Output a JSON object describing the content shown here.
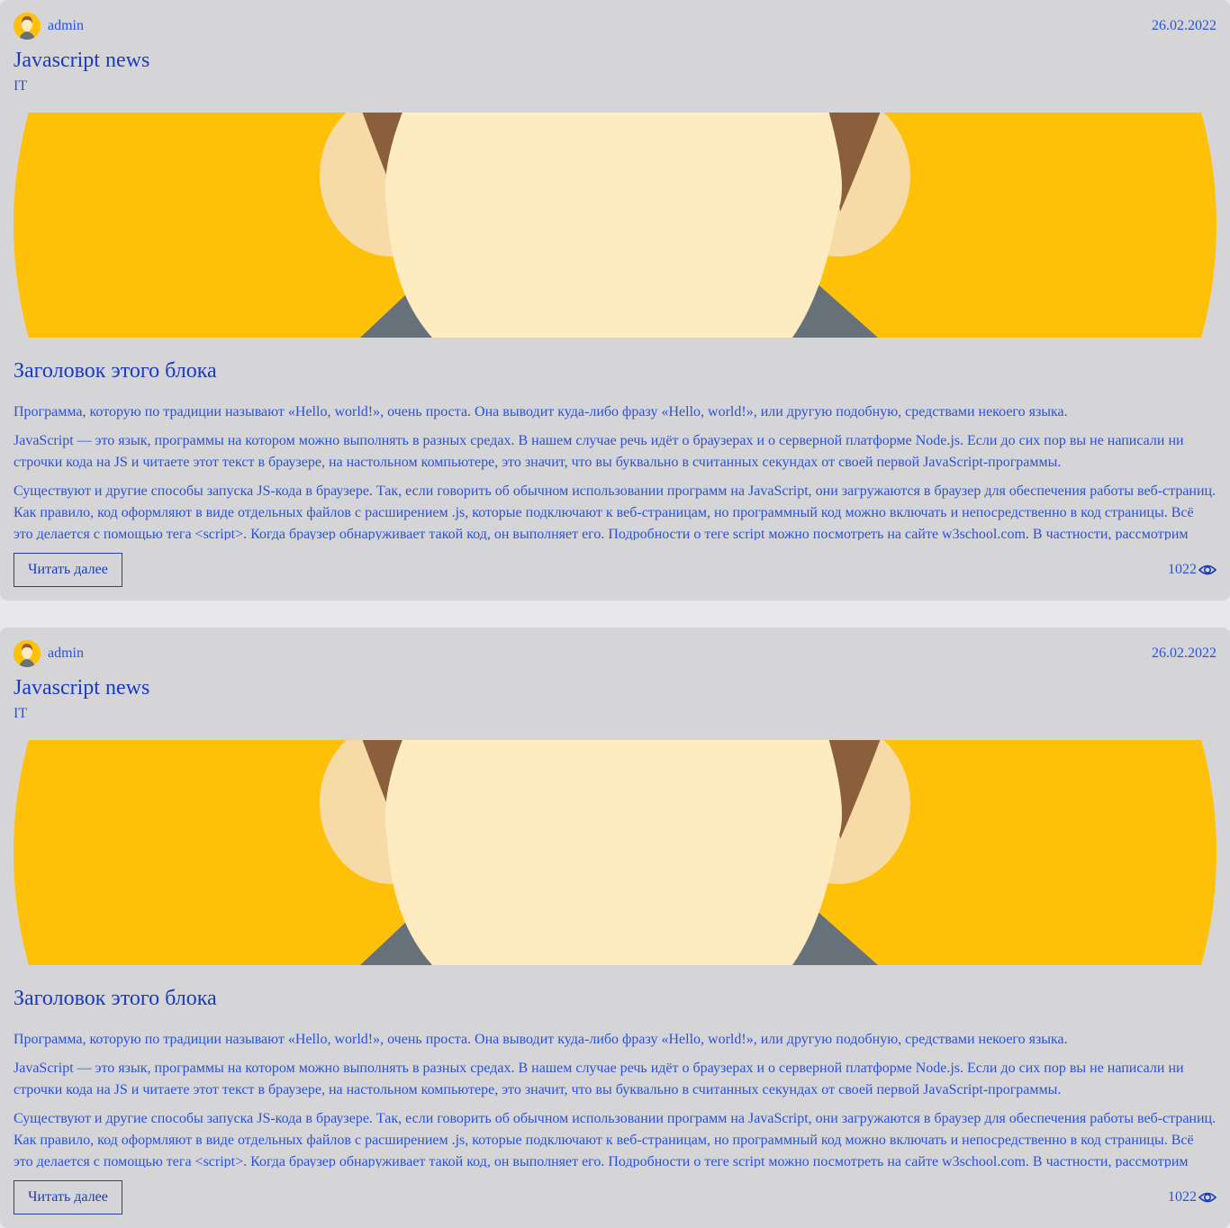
{
  "posts": [
    {
      "author": "admin",
      "date": "26.02.2022",
      "title": "Javascript news",
      "category": "IT",
      "heading": "Заголовок этого блока",
      "paragraphs": [
        "Программа, которую по традиции называют «Hello, world!», очень проста. Она выводит куда-либо фразу «Hello, world!», или другую подобную, средствами некоего языка.",
        "JavaScript — это язык, программы на котором можно выполнять в разных средах. В нашем случае речь идёт о браузерах и о серверной платформе Node.js. Если до сих пор вы не написали ни строчки кода на JS и читаете этот текст в браузере, на настольном компьютере, это значит, что вы буквально в считанных секундах от своей первой JavaScript-программы.",
        "Существуют и другие способы запуска JS-кода в браузере. Так, если говорить об обычном использовании программ на JavaScript, они загружаются в браузер для обеспечения работы веб-страниц. Как правило, код оформляют в виде отдельных файлов с расширением .js, которые подключают к веб-страницам, но программный код можно включать и непосредственно в код страницы. Всё это делается с помощью тега <script>. Когда браузер обнаруживает такой код, он выполняет его. Подробности о теге script можно посмотреть на сайте w3school.com. В частности, рассмотрим"
      ],
      "read_more": "Читать далее",
      "views": "1022"
    },
    {
      "author": "admin",
      "date": "26.02.2022",
      "title": "Javascript news",
      "category": "IT",
      "heading": "Заголовок этого блока",
      "paragraphs": [
        "Программа, которую по традиции называют «Hello, world!», очень проста. Она выводит куда-либо фразу «Hello, world!», или другую подобную, средствами некоего языка.",
        "JavaScript — это язык, программы на котором можно выполнять в разных средах. В нашем случае речь идёт о браузерах и о серверной платформе Node.js. Если до сих пор вы не написали ни строчки кода на JS и читаете этот текст в браузере, на настольном компьютере, это значит, что вы буквально в считанных секундах от своей первой JavaScript-программы.",
        "Существуют и другие способы запуска JS-кода в браузере. Так, если говорить об обычном использовании программ на JavaScript, они загружаются в браузер для обеспечения работы веб-страниц. Как правило, код оформляют в виде отдельных файлов с расширением .js, которые подключают к веб-страницам, но программный код можно включать и непосредственно в код страницы. Всё это делается с помощью тега <script>. Когда браузер обнаруживает такой код, он выполняет его. Подробности о теге script можно посмотреть на сайте w3school.com. В частности, рассмотрим"
      ],
      "read_more": "Читать далее",
      "views": "1022"
    }
  ],
  "icons": {
    "avatar": "user-avatar-icon",
    "views": "eye-icon"
  },
  "colors": {
    "page_bg": "#e8e8ea",
    "card_bg": "#d5d5d8",
    "text": "#2a52d6",
    "title": "#1a3bbf",
    "image_yellow": "#ffc107",
    "image_skin": "#ffebc0",
    "image_ear": "#f6dba6",
    "image_hair": "#8b5e3c",
    "image_shirt": "#66717a"
  }
}
